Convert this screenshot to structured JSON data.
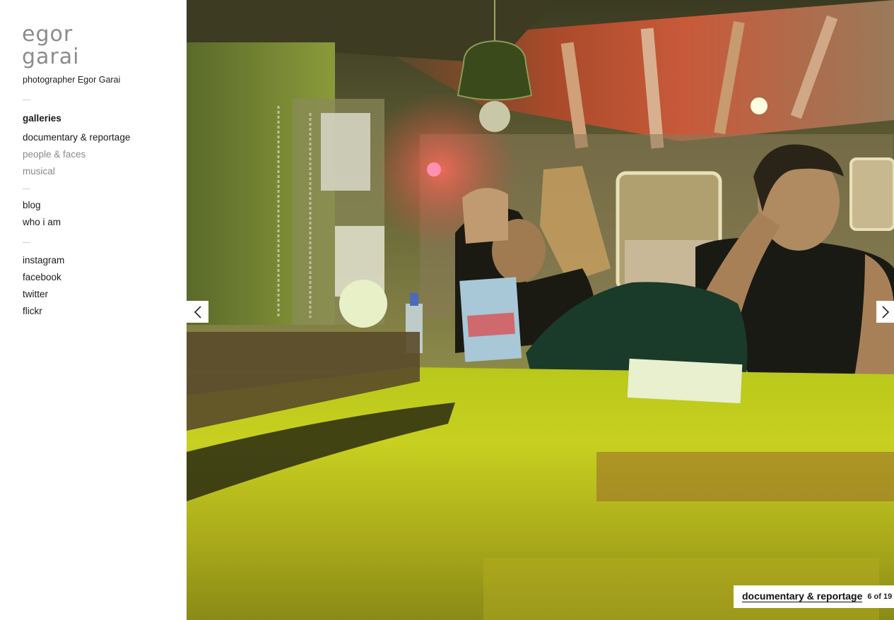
{
  "site": {
    "logo_text_line1": "egor",
    "logo_text_line2": "garai",
    "tagline": "photographer Egor Garai"
  },
  "nav": {
    "galleries_heading": "galleries",
    "galleries": [
      {
        "label": "documentary & reportage"
      },
      {
        "label": "people & faces"
      },
      {
        "label": "musical"
      }
    ],
    "pages": [
      {
        "label": "blog"
      },
      {
        "label": "who i am"
      }
    ],
    "social": [
      {
        "label": "instagram"
      },
      {
        "label": "facebook"
      },
      {
        "label": "twitter"
      },
      {
        "label": "flickr"
      }
    ]
  },
  "viewer": {
    "prev_icon": "chevron-left-icon",
    "next_icon": "chevron-right-icon",
    "gallery_label": "documentary & reportage",
    "counter": "6 of 19"
  },
  "colors": {
    "logo_gray": "#8c8c8c",
    "muted_nav": "#8a8a8a",
    "text": "#1a1a1a"
  }
}
